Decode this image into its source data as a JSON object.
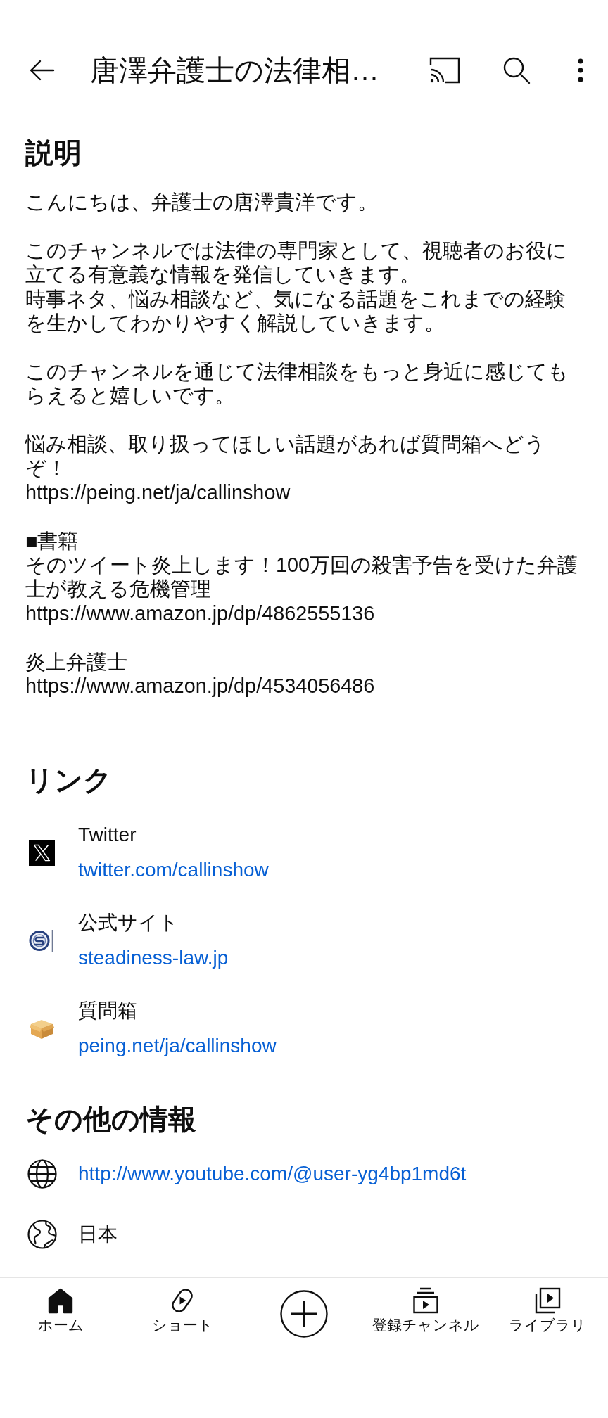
{
  "top_bar": {
    "title": "唐澤弁護士の法律相…"
  },
  "description": {
    "heading": "説明",
    "paragraphs": [
      [
        "こんにちは、弁護士の唐澤貴洋です。"
      ],
      [
        "このチャンネルでは法律の専門家として、視聴者のお役に立てる有意義な情報を発信していきます。",
        "時事ネタ、悩み相談など、気になる話題をこれまでの経験を生かしてわかりやすく解説していきます。"
      ],
      [
        "このチャンネルを通じて法律相談をもっと身近に感じてもらえると嬉しいです。"
      ],
      [
        "悩み相談、取り扱ってほしい話題があれば質問箱へどうぞ！",
        "https://peing.net/ja/callinshow"
      ],
      [
        "■書籍",
        "そのツイート炎上します！100万回の殺害予告を受けた弁護士が教える危機管理",
        "https://www.amazon.jp/dp/4862555136"
      ],
      [
        "炎上弁護士",
        "https://www.amazon.jp/dp/4534056486"
      ]
    ]
  },
  "links": {
    "heading": "リンク",
    "items": [
      {
        "kind": "x",
        "title": "Twitter",
        "url": "twitter.com/callinshow"
      },
      {
        "kind": "site",
        "title": "公式サイト",
        "url": "steadiness-law.jp"
      },
      {
        "kind": "box",
        "title": "質問箱",
        "url": "peing.net/ja/callinshow"
      }
    ]
  },
  "more_info": {
    "heading": "その他の情報",
    "items": [
      {
        "kind": "website",
        "text": "http://www.youtube.com/@user-yg4bp1md6t"
      },
      {
        "kind": "country",
        "text": "日本"
      }
    ]
  },
  "bottom_nav": {
    "items": [
      {
        "kind": "home",
        "label": "ホーム",
        "selected": true
      },
      {
        "kind": "shorts",
        "label": "ショート",
        "selected": false
      },
      {
        "kind": "create",
        "selected": false
      },
      {
        "kind": "subscriptions",
        "label": "登録チャンネル",
        "selected": false
      },
      {
        "kind": "library",
        "label": "ライブラリ",
        "selected": false
      }
    ]
  }
}
